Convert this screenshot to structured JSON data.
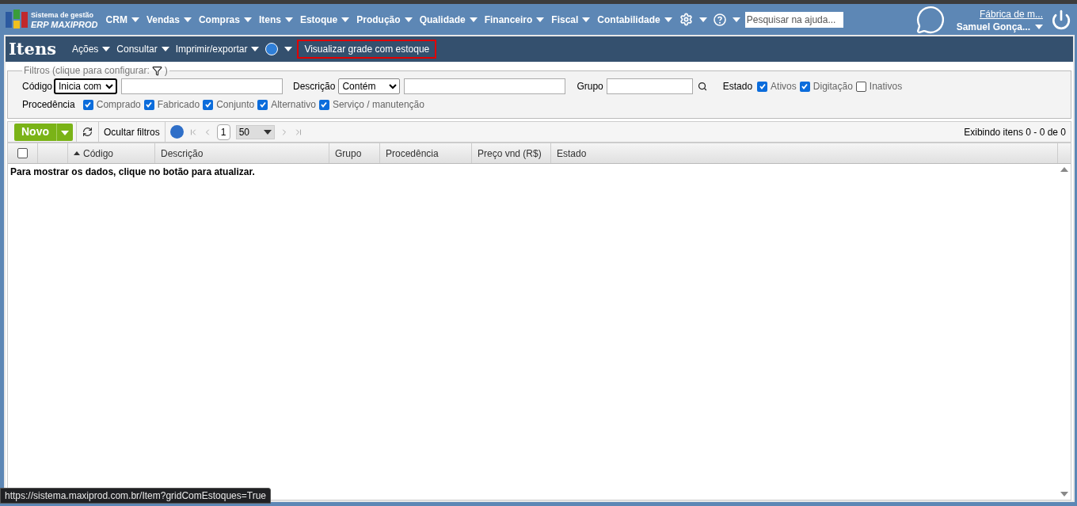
{
  "header": {
    "logo_line1": "Sistema de gestão",
    "logo_line2": "ERP MAXIPROD",
    "menu": [
      {
        "label": "CRM"
      },
      {
        "label": "Vendas"
      },
      {
        "label": "Compras"
      },
      {
        "label": "Itens"
      },
      {
        "label": "Estoque"
      },
      {
        "label": "Produção"
      },
      {
        "label": "Qualidade"
      },
      {
        "label": "Financeiro"
      },
      {
        "label": "Fiscal"
      },
      {
        "label": "Contabilidade"
      }
    ],
    "search": {
      "placeholder": "Pesquisar na ajuda..."
    },
    "company": "Fábrica de m...",
    "user": "Samuel Gonça..."
  },
  "page": {
    "title": "Itens",
    "actions": [
      {
        "label": "Ações"
      },
      {
        "label": "Consultar"
      },
      {
        "label": "Imprimir/exportar"
      }
    ],
    "view_button": {
      "label": "Visualizar grade com estoque",
      "highlighted": true
    }
  },
  "filters": {
    "legend_start": "Filtros (clique para configurar:",
    "legend_end": ")",
    "codigo": {
      "label": "Código",
      "mode": "Inicia com"
    },
    "descricao": {
      "label": "Descrição",
      "mode": "Contém"
    },
    "grupo": {
      "label": "Grupo"
    },
    "estado": {
      "label": "Estado",
      "options": [
        {
          "label": "Ativos",
          "checked": true
        },
        {
          "label": "Digitação",
          "checked": true
        },
        {
          "label": "Inativos",
          "checked": false
        }
      ]
    },
    "procedencia": {
      "label": "Procedência",
      "options": [
        {
          "label": "Comprado",
          "checked": true
        },
        {
          "label": "Fabricado",
          "checked": true
        },
        {
          "label": "Conjunto",
          "checked": true
        },
        {
          "label": "Alternativo",
          "checked": true
        },
        {
          "label": "Serviço / manutenção",
          "checked": true
        }
      ]
    }
  },
  "toolbar": {
    "new_button": "Novo",
    "hide_filters": "Ocultar filtros",
    "page": "1",
    "page_size": "50",
    "summary": "Exibindo itens 0 - 0 de 0"
  },
  "table": {
    "select_all": {
      "checked": false
    },
    "columns": [
      {
        "label": "Código",
        "sorted": true
      },
      {
        "label": "Descrição",
        "sorted": false
      },
      {
        "label": "Grupo",
        "sorted": false
      },
      {
        "label": "Procedência",
        "sorted": false
      },
      {
        "label": "Preço vnd (R$)",
        "sorted": false
      },
      {
        "label": "Estado",
        "sorted": false
      }
    ],
    "empty_message": "Para mostrar os dados, clique no botão para atualizar."
  },
  "status_url": "https://sistema.maxiprod.com.br/Item?gridComEstoques=True"
}
